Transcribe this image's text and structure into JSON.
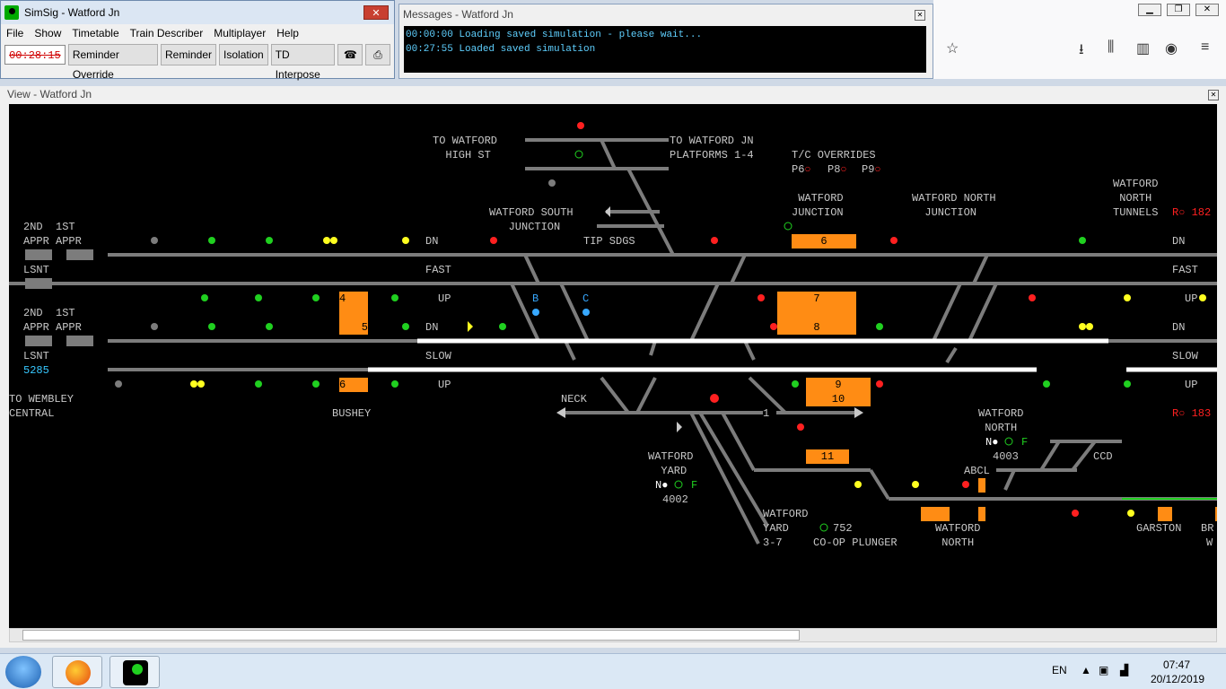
{
  "main_window": {
    "title": "SimSig - Watford Jn",
    "close_label": "✕",
    "menu": [
      "File",
      "Show",
      "Timetable",
      "Train Describer",
      "Multiplayer",
      "Help"
    ],
    "clock": "00:28:15",
    "buttons": [
      "Reminder Override",
      "Reminder",
      "Isolation",
      "TD Interpose"
    ]
  },
  "messages_window": {
    "title": "Messages - Watford Jn",
    "lines": [
      "00:00:00 Loading saved simulation - please wait...",
      "00:27:55 Loaded saved simulation"
    ]
  },
  "view_window": {
    "title": "View - Watford Jn",
    "labels": {
      "to_watford_high_st": "TO WATFORD\n  HIGH ST",
      "to_watford_jn_platforms": "TO WATFORD JN\nPLATFORMS 1-4",
      "tc_overrides": "T/C OVERRIDES",
      "p6": "P6",
      "p8": "P8",
      "p9": "P9",
      "watford_junction": " WATFORD\nJUNCTION",
      "watford_north_junction": "WATFORD NORTH\n  JUNCTION",
      "watford_north_tunnels": "WATFORD\n NORTH\nTUNNELS",
      "watford_south_junction": "WATFORD SOUTH\n   JUNCTION",
      "tip_sdgs": "TIP SDGS",
      "appr_top": "2ND  1ST\nAPPR APPR",
      "lsnt_top": "LSNT",
      "appr_bottom": "2ND  1ST\nAPPR APPR",
      "lsnt_bottom": "LSNT",
      "code_5285": "5285",
      "fast": "FAST",
      "fast_right": "FAST",
      "slow": "SLOW",
      "slow_right": "SLOW",
      "dn_1": "DN",
      "dn_2": "DN",
      "dn_right_1": "DN",
      "dn_right_2": "DN",
      "up_1": "UP",
      "up_2": "UP",
      "up_right_1": "UP",
      "up_right_2": "UP",
      "b": "B",
      "c": "C",
      "to_wembley": "TO WEMBLEY\nCENTRAL",
      "bushey": "BUSHEY",
      "neck": "NECK",
      "watford_yard": "WATFORD\n  YARD",
      "watford_north_4003": "WATFORD\n NORTH",
      "code_4003": "4003",
      "code_4002": "4002",
      "ccd": "CCD",
      "abcl": "ABCL",
      "watford_yard_3_7": "WATFORD\nYARD\n3-7",
      "code_752": "752",
      "coop_plunger": "CO-OP PLUNGER",
      "watford_north_bottom": "WATFORD\n NORTH",
      "garston": "GARSTON",
      "r_182": "R○ 182",
      "r_183": "R○ 183",
      "br": "BR",
      "w": "W",
      "n_1": "N●",
      "n_2": "N●",
      "f_1": "F",
      "f_2": "F"
    },
    "berths": {
      "b4": "4",
      "b5": "5",
      "b6": "6",
      "b6b": "6",
      "b7": "7",
      "b8": "8",
      "b9": "9",
      "b10": "10",
      "b11": "11",
      "b1": "1"
    }
  },
  "taskbar": {
    "lang": "EN",
    "time": "07:47",
    "date": "20/12/2019"
  },
  "colors": {
    "track": "#7c7c7c",
    "berth": "#ff8c14",
    "signal_red": "#ff2020",
    "signal_green": "#20d020",
    "signal_yellow": "#ffff20",
    "signal_blue": "#37a8ff",
    "occupied": "#ffffff"
  }
}
